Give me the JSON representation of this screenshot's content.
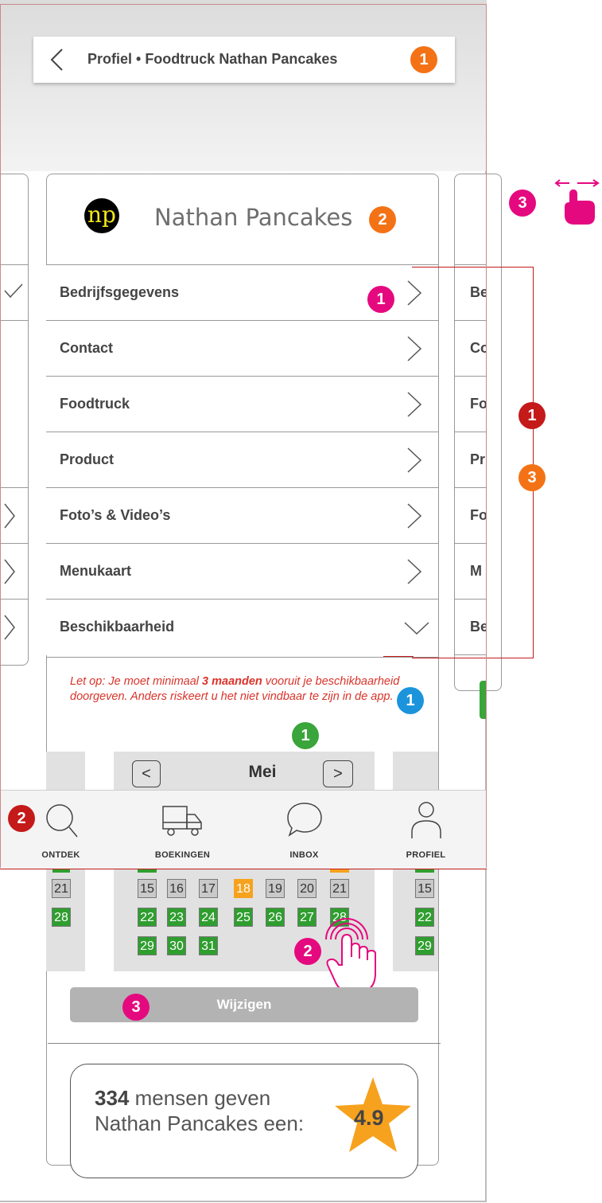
{
  "header": {
    "title": "Profiel • Foodtruck Nathan Pancakes",
    "badge": "1"
  },
  "profile": {
    "logo_text": "np",
    "name": "Nathan Pancakes",
    "badge": "2"
  },
  "swipe": {
    "badge": "3"
  },
  "menu": {
    "items": [
      {
        "label": "Bedrijfsgegevens",
        "badge": "1"
      },
      {
        "label": "Contact"
      },
      {
        "label": "Foodtruck"
      },
      {
        "label": "Product"
      },
      {
        "label": "Foto’s & Video’s"
      },
      {
        "label": "Menukaart"
      },
      {
        "label": "Beschikbaarheid"
      }
    ]
  },
  "right_card": {
    "items": [
      "Be",
      "Co",
      "Fo",
      "Pr",
      "Fo",
      "M",
      "Be"
    ]
  },
  "bracket": {
    "badge_a": "1",
    "badge_b": "3"
  },
  "notice": {
    "prefix": "Let op: Je moet minimaal ",
    "emphasis": "3 maanden",
    "suffix": " vooruit je beschikbaarheid doorgeven. Anders riskeert u het niet vindbaar te zijn in de app.",
    "badge_green": "1",
    "badge_blue": "1"
  },
  "calendar": {
    "month": "Mei",
    "prev": "<",
    "next": ">",
    "rows": [
      [
        {
          "d": "15",
          "s": "gray"
        },
        {
          "d": "16",
          "s": "gray"
        },
        {
          "d": "17",
          "s": "gray"
        },
        {
          "d": "18",
          "s": "orange"
        },
        {
          "d": "19",
          "s": "gray"
        },
        {
          "d": "20",
          "s": "gray"
        },
        {
          "d": "21",
          "s": "gray"
        }
      ],
      [
        {
          "d": "22",
          "s": "green"
        },
        {
          "d": "23",
          "s": "green"
        },
        {
          "d": "24",
          "s": "green"
        },
        {
          "d": "25",
          "s": "green"
        },
        {
          "d": "26",
          "s": "green"
        },
        {
          "d": "27",
          "s": "green"
        },
        {
          "d": "28",
          "s": "green"
        }
      ],
      [
        {
          "d": "29",
          "s": "green"
        },
        {
          "d": "30",
          "s": "green"
        },
        {
          "d": "31",
          "s": "green"
        }
      ]
    ],
    "left_days": [
      {
        "d": "21",
        "s": "gray"
      },
      {
        "d": "28",
        "s": "green"
      }
    ],
    "right_days": [
      {
        "d": "15",
        "s": "gray"
      },
      {
        "d": "22",
        "s": "green"
      },
      {
        "d": "29",
        "s": "green"
      }
    ],
    "tap_badge": "2"
  },
  "nav": {
    "badge": "2",
    "items": [
      {
        "label": "ONTDEK",
        "icon": "search-icon"
      },
      {
        "label": "BOEKINGEN",
        "icon": "truck-icon"
      },
      {
        "label": "INBOX",
        "icon": "chat-icon"
      },
      {
        "label": "PROFIEL",
        "icon": "user-icon"
      }
    ]
  },
  "edit": {
    "label": "Wijzigen",
    "badge": "3"
  },
  "rating": {
    "count": "334",
    "line1": " mensen geven",
    "line2": "Nathan Pancakes een:",
    "score": "4.9"
  },
  "colors": {
    "orange": "#f47216",
    "magenta": "#e5097f",
    "red": "#c41a1a",
    "green": "#3aa53a",
    "blue": "#1b94dc",
    "notice": "#d9342b"
  }
}
